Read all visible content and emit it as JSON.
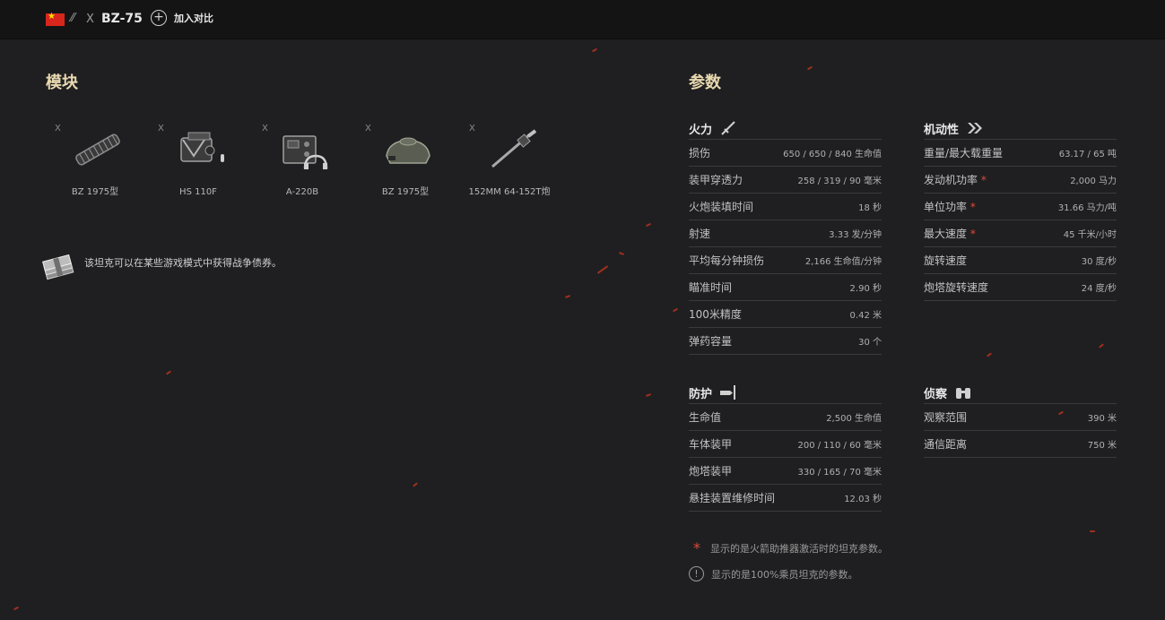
{
  "header": {
    "tier": "X",
    "tank_name": "BZ-75",
    "add_compare_label": "加入对比",
    "flag_icon": "china-flag-icon",
    "tier_icon": "heavy-tank-class-icon"
  },
  "modules": {
    "title": "模块",
    "items": [
      {
        "tier": "X",
        "name": "BZ 1975型",
        "icon": "tracks-icon"
      },
      {
        "tier": "X",
        "name": "HS 110F",
        "icon": "engine-icon"
      },
      {
        "tier": "X",
        "name": "A-220B",
        "icon": "radio-icon"
      },
      {
        "tier": "X",
        "name": "BZ 1975型",
        "icon": "turret-icon"
      },
      {
        "tier": "X",
        "name": "152MM 64-152T炮",
        "icon": "gun-icon"
      }
    ],
    "bonds_text": "该坦克可以在某些游戏模式中获得战争债券。"
  },
  "params": {
    "title": "参数",
    "firepower": {
      "title": "火力",
      "rows": [
        {
          "label": "损伤",
          "value": "650 / 650 / 840 生命值"
        },
        {
          "label": "装甲穿透力",
          "value": "258 / 319 / 90 毫米"
        },
        {
          "label": "火炮装填时间",
          "value": "18 秒"
        },
        {
          "label": "射速",
          "value": "3.33 发/分钟"
        },
        {
          "label": "平均每分钟损伤",
          "value": "2,166 生命值/分钟"
        },
        {
          "label": "瞄准时间",
          "value": "2.90 秒"
        },
        {
          "label": "100米精度",
          "value": "0.42 米"
        },
        {
          "label": "弹药容量",
          "value": "30 个"
        }
      ]
    },
    "mobility": {
      "title": "机动性",
      "rows": [
        {
          "label": "重量/最大载重量",
          "value": "63.17 / 65 吨",
          "star": ""
        },
        {
          "label": "发动机功率",
          "value": "2,000 马力",
          "star": "*"
        },
        {
          "label": "单位功率",
          "value": "31.66 马力/吨",
          "star": "*"
        },
        {
          "label": "最大速度",
          "value": "45 千米/小时",
          "star": "*"
        },
        {
          "label": "旋转速度",
          "value": "30 度/秒",
          "star": ""
        },
        {
          "label": "炮塔旋转速度",
          "value": "24 度/秒",
          "star": ""
        }
      ]
    },
    "protection": {
      "title": "防护",
      "rows": [
        {
          "label": "生命值",
          "value": "2,500 生命值"
        },
        {
          "label": "车体装甲",
          "value": "200 / 110 / 60 毫米"
        },
        {
          "label": "炮塔装甲",
          "value": "330 / 165 / 70 毫米"
        },
        {
          "label": "悬挂装置维修时间",
          "value": "12.03 秒"
        }
      ]
    },
    "spotting": {
      "title": "侦察",
      "rows": [
        {
          "label": "观察范围",
          "value": "390 米"
        },
        {
          "label": "通信距离",
          "value": "750 米"
        }
      ]
    },
    "notes": {
      "booster": "显示的是火箭助推器激活时的坦克参数。",
      "crew": "显示的是100%乘员坦克的参数。",
      "star_symbol": "*",
      "info_symbol": "!"
    }
  },
  "colors": {
    "background": "#1f1f21",
    "topbar": "#141414",
    "title_gold": "#e8d9b0",
    "accent_red": "#e04a3a"
  }
}
